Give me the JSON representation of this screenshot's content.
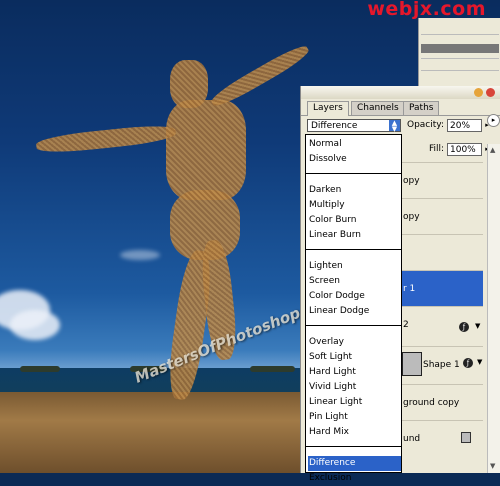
{
  "logo": "webjx.com",
  "watermark": "MastersOfPhotoshop.com",
  "palette": {
    "tabs": [
      "Layers",
      "Channels",
      "Paths"
    ],
    "blend_mode": "Difference",
    "opacity_label": "Opacity:",
    "opacity_value": "20%",
    "fill_label": "Fill:",
    "fill_value": "100%",
    "layers": [
      {
        "label": "opy",
        "selected": false
      },
      {
        "label": "opy",
        "selected": false
      },
      {
        "label": "",
        "selected": false
      },
      {
        "label": "r 1",
        "selected": true
      },
      {
        "label": "2",
        "selected": false
      },
      {
        "label": "Shape 1",
        "selected": false
      },
      {
        "label": "ground copy",
        "selected": false
      },
      {
        "label": "und",
        "selected": false
      }
    ]
  },
  "blend_menu": {
    "groups": [
      [
        "Normal",
        "Dissolve"
      ],
      [
        "Darken",
        "Multiply",
        "Color Burn",
        "Linear Burn"
      ],
      [
        "Lighten",
        "Screen",
        "Color Dodge",
        "Linear Dodge"
      ],
      [
        "Overlay",
        "Soft Light",
        "Hard Light",
        "Vivid Light",
        "Linear Light",
        "Pin Light",
        "Hard Mix"
      ],
      [
        "Difference",
        "Exclusion"
      ]
    ],
    "selected": "Difference"
  },
  "colors": {
    "accent": "#2b62c8",
    "logo": "#e5172b"
  }
}
